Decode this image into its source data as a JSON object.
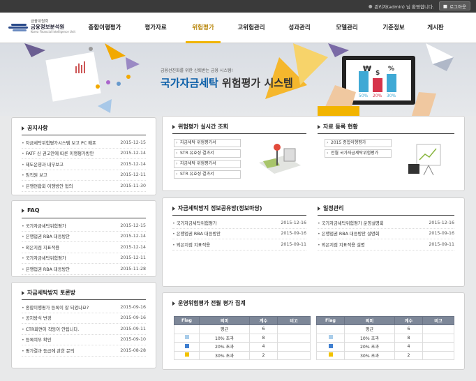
{
  "topbar": {
    "user_text": "관리자(admin) 님 환영합니다.",
    "logout_label": "로그아웃"
  },
  "logo": {
    "line1": "금융위원회",
    "line2": "금융정보분석원",
    "line3": "Korea Financial Intelligence Unit"
  },
  "nav": {
    "items": [
      "종합이행평가",
      "평가자료",
      "위험평가",
      "고위험관리",
      "성과관리",
      "모델관리",
      "기준정보",
      "게시판"
    ],
    "active": "위험평가"
  },
  "visual": {
    "subtitle": "금융선진화를 위한 신뢰받는 금융 시스템!",
    "title_accent": "국가자금세탁",
    "title_rest": " 위험평가 시스템",
    "bar_labels": [
      "50%",
      "20%",
      "30%"
    ]
  },
  "notice": {
    "title": "공지사항",
    "items": [
      {
        "text": "자금세탁위험평가시스템 보고 PC 배포",
        "date": "2015-12-15"
      },
      {
        "text": "FATF 신 권고안에 따른 이행평가방안",
        "date": "2015-12-14"
      },
      {
        "text": "제도운영과 내부보고",
        "date": "2015-12-14"
      },
      {
        "text": "임직원 보고",
        "date": "2015-12-11"
      },
      {
        "text": "은행연합회 이행방안 협의",
        "date": "2015-11-30"
      }
    ]
  },
  "faq": {
    "title": "FAQ",
    "items": [
      {
        "text": "국가자금세탁위험평가",
        "date": "2015-12-15"
      },
      {
        "text": "은행업권 RBA 대응방안",
        "date": "2015-12-14"
      },
      {
        "text": "외은지점 지표적용",
        "date": "2015-12-14"
      },
      {
        "text": "국가자금세탁위험평가",
        "date": "2015-12-11"
      },
      {
        "text": "은행업권 RBA 대응방안",
        "date": "2015-11-28"
      }
    ]
  },
  "forum": {
    "title": "자금세탁방지 토론방",
    "items": [
      {
        "text": "종합이행평가 등록이 잘 되었나요?",
        "date": "2015-09-16"
      },
      {
        "text": "공지방식 변경",
        "date": "2015-09-16"
      },
      {
        "text": "CTR화면이 작동이 안됩니다.",
        "date": "2015-09-11"
      },
      {
        "text": "등록여부 확인",
        "date": "2015-09-10"
      },
      {
        "text": "평가결과 등급에 관한 문의",
        "date": "2015-08-28"
      }
    ]
  },
  "realtime": {
    "title": "위험평가 실시간 조회",
    "items": [
      "자금세탁 위험평가서",
      "STR 유효성 결과서",
      "자금세탁 위험평가서",
      "STR 유효성 결과서"
    ]
  },
  "materials": {
    "title": "자료 등록 현황",
    "items": [
      "2015 종합이행평가",
      "전월 국가자금세탁위험평가"
    ]
  },
  "board": {
    "title": "자금세탁방지 정보공유방(정보마당)",
    "items": [
      {
        "text": "국가자금세탁위험평가",
        "date": "2015-12-16"
      },
      {
        "text": "은행업권 RBA 대응방안",
        "date": "2015-09-16"
      },
      {
        "text": "외은지점 지표적용",
        "date": "2015-09-11"
      }
    ]
  },
  "schedule": {
    "title": "일정관리",
    "items": [
      {
        "text": "국가자금세탁위험평가 운영설명회",
        "date": "2015-12-16"
      },
      {
        "text": "은행업권 RBA 대응방안 설명회",
        "date": "2015-09-16"
      },
      {
        "text": "외은지점 지표적용 설명",
        "date": "2015-09-11"
      }
    ]
  },
  "summary": {
    "title": "운영위험평가 전월 평가 집계",
    "headers": [
      "Flag",
      "의미",
      "계수",
      "비고"
    ],
    "rows": [
      {
        "color": "",
        "meaning": "평균",
        "count": "6",
        "note": ""
      },
      {
        "color": "#a9cdea",
        "meaning": "10% 초과",
        "count": "8",
        "note": ""
      },
      {
        "color": "#3f7fd0",
        "meaning": "20% 초과",
        "count": "4",
        "note": ""
      },
      {
        "color": "#f2c200",
        "meaning": "30% 초과",
        "count": "2",
        "note": ""
      }
    ]
  }
}
